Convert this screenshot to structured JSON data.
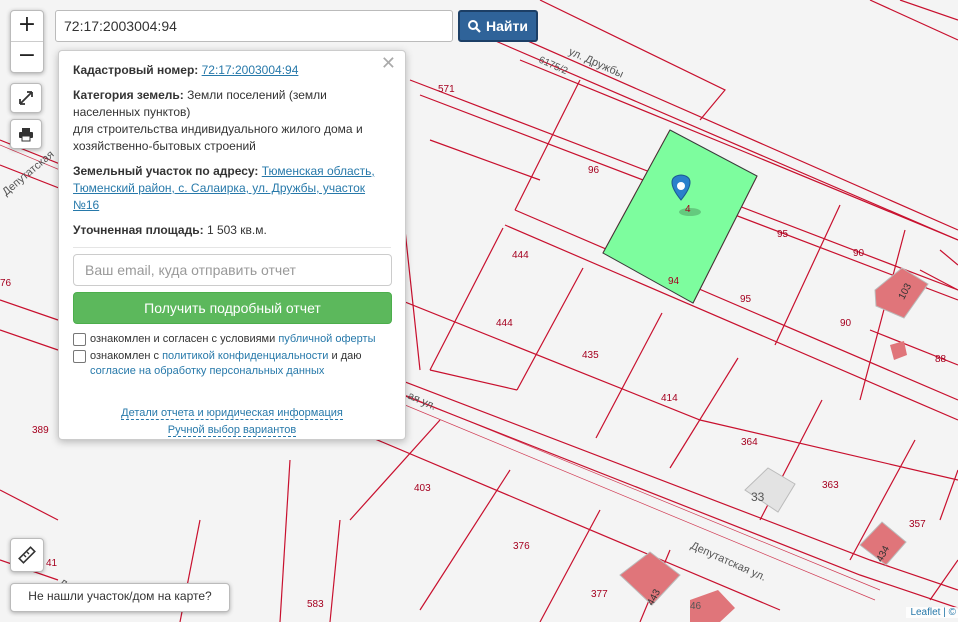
{
  "search": {
    "value": "72:17:2003004:94",
    "button_label": "Найти"
  },
  "zoom": {
    "in": "+",
    "out": "−"
  },
  "popup": {
    "cad_label": "Кадастровый номер:",
    "cad_value": "72:17:2003004:94",
    "cat_label": "Категория земель:",
    "cat_value": "Земли поселений (земли населенных пунктов)",
    "purpose": "для строительства индивидуального жилого дома и хозяйственно-бытовых строений",
    "addr_label": "Земельный участок по адресу:",
    "addr_value": "Тюменская область, Тюменский район, с. Салаирка, ул. Дружбы, участок №16",
    "area_label": "Уточненная площадь:",
    "area_value": "1 503 кв.м.",
    "email_placeholder": "Ваш email, куда отправить отчет",
    "report_button": "Получить подробный отчет",
    "check1_text": "ознакомлен и согласен с условиями ",
    "check1_link": "публичной оферты",
    "check2_text": "ознакомлен с ",
    "check2_link": "политикой конфиденциальности",
    "check2_text2": " и даю ",
    "check2_link2": "согласие на обработку персональных данных",
    "details_link": "Детали отчета и юридическая информация",
    "manual_link": "Ручной выбор вариантов"
  },
  "map": {
    "parcel_labels": [
      "571",
      "96",
      "4",
      "95",
      "90",
      "103",
      "444",
      "444",
      "94",
      "95",
      "90",
      "88",
      "435",
      "414",
      "364",
      "33",
      "363",
      "357",
      "434",
      "403",
      "376",
      "377",
      "443",
      "46",
      "583",
      "389",
      "76",
      "41"
    ],
    "streets": [
      "ул. Дружбы",
      "6175/2",
      "Депутатская",
      "Депутатская ул.",
      "ая ул.",
      "Де"
    ]
  },
  "not_found": "Не нашли участок/дом на карте?",
  "attribution": "Leaflet",
  "colors": {
    "parcel_line": "#c8102e",
    "selected_fill": "#7dfd9e",
    "building": "#e0757a",
    "marker": "#2a81cb",
    "button": "#2f6399",
    "report": "#5cb85c"
  }
}
